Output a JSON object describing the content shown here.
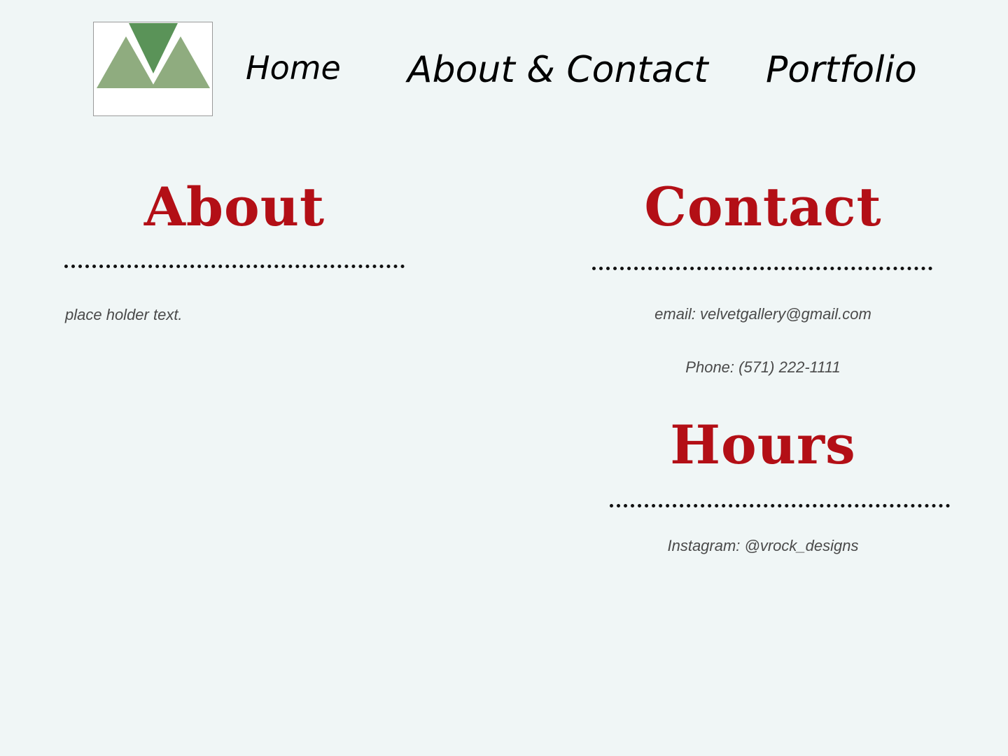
{
  "nav": {
    "logo_icon": "mountain-v-logo-icon",
    "home_label": "Home",
    "about_contact_label": "About & Contact",
    "portfolio_label": "Portfolio"
  },
  "about": {
    "heading": "About",
    "body": "place holder text."
  },
  "contact": {
    "heading": "Contact",
    "email": "email: velvetgallery@gmail.com",
    "phone": "Phone: (571) 222-1111"
  },
  "hours": {
    "heading": "Hours",
    "instagram": "Instagram: @vrock_designs"
  },
  "colors": {
    "background": "#f0f6f6",
    "heading_red": "#b30f16",
    "logo_light_green": "#8fac7f",
    "logo_dark_green": "#5a9358"
  }
}
